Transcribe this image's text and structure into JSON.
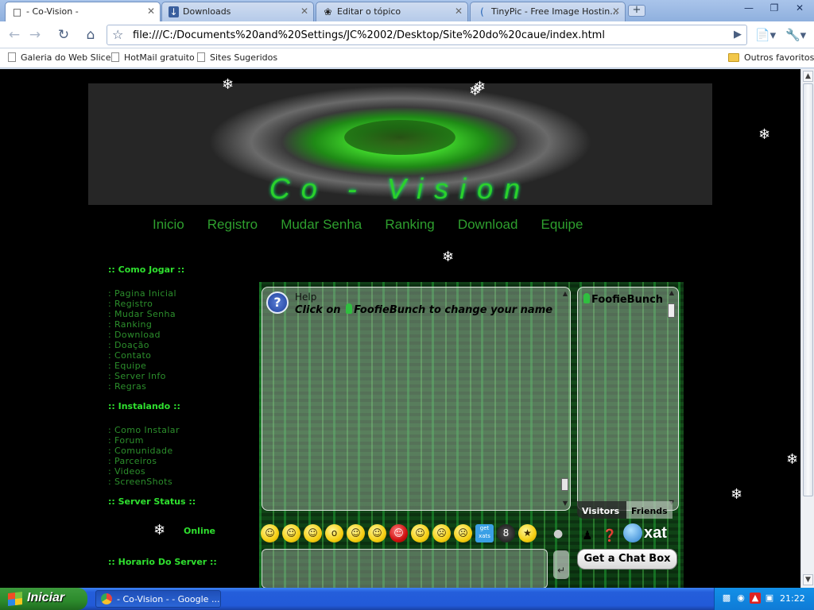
{
  "browser": {
    "tabs": [
      {
        "label": "- Co-Vision -",
        "icon": "page-icon",
        "active": true
      },
      {
        "label": "Downloads",
        "icon": "download-icon",
        "active": false
      },
      {
        "label": "Editar o tópico",
        "icon": "swirl-icon",
        "active": false
      },
      {
        "label": "TinyPic - Free Image Hostin...",
        "icon": "tinypic-icon",
        "active": false
      }
    ],
    "url": "file:///C:/Documents%20and%20Settings/JC%2002/Desktop/Site%20do%20caue/index.html",
    "bookmarks": [
      "Galeria do Web Slice",
      "HotMail gratuito",
      "Sites Sugeridos"
    ],
    "other_bookmarks": "Outros favoritos"
  },
  "site": {
    "banner_logo": "Co - Vision",
    "nav": [
      "Inicio",
      "Registro",
      "Mudar Senha",
      "Ranking",
      "Download",
      "Equipe"
    ],
    "sidebar": {
      "como_jogar": {
        "heading": ":: Como Jogar ::",
        "items": [
          ": Pagina Inicial",
          ": Registro",
          ": Mudar Senha",
          ": Ranking",
          ": Download",
          ": Doação",
          ": Contato",
          ": Equipe",
          ": Server Info",
          ": Regras"
        ]
      },
      "instalando": {
        "heading": ":: Instalando ::",
        "items": [
          ": Como Instalar",
          ": Forum",
          ": Comunidade",
          ": Parceiros",
          ": Videos",
          ": ScreenShots"
        ]
      },
      "server_status": {
        "heading": ":: Server Status ::",
        "value": "Online"
      },
      "horario": {
        "heading": ":: Horario Do Server ::"
      }
    },
    "chat": {
      "help_title": "Help",
      "help_message_prefix": "Click on",
      "help_username": "FoofieBunch",
      "help_message_suffix": "to change your name",
      "side_username": "FoofieBunch",
      "tab_visitors": "Visitors",
      "tab_friends": "Friends",
      "brand": "xat",
      "get_box": "Get a Chat Box",
      "getxats": "get xats"
    },
    "colors": {
      "accent_green": "#2fe02f",
      "link_green": "#2c8f2c",
      "background": "#000000"
    }
  },
  "taskbar": {
    "start_label": "Iniciar",
    "task_label": "- Co-Vision - - Google ...",
    "clock": "21:22"
  }
}
